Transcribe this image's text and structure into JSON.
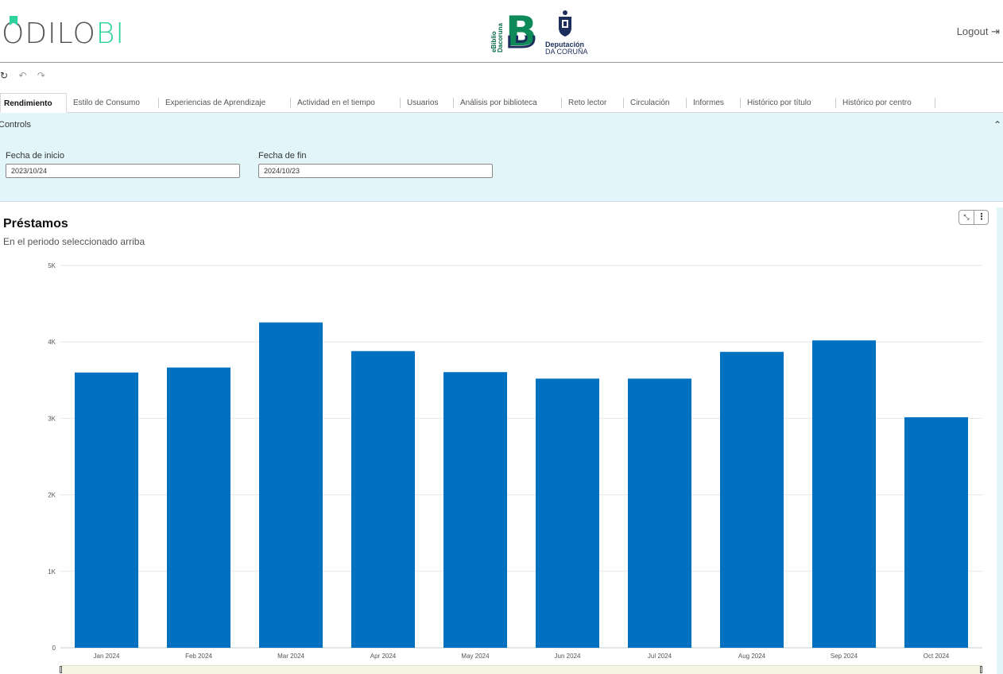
{
  "header": {
    "brand_main": "ODILO",
    "brand_accent": "BI",
    "ebiblio_label": "eBiblio Dacoruna",
    "partner_line1": "Deputación",
    "partner_line2": "DA CORUÑA",
    "logout_label": "Logout"
  },
  "toolbar": {
    "refresh_icon": "refresh-icon",
    "undo_icon": "undo-icon",
    "redo_icon": "redo-icon"
  },
  "tabs": [
    {
      "label": "Rendimiento",
      "active": true
    },
    {
      "label": "Estilo de Consumo"
    },
    {
      "label": "Experiencias de Aprendizaje"
    },
    {
      "label": "Actividad en el tiempo"
    },
    {
      "label": "Usuarios"
    },
    {
      "label": "Análisis por biblioteca"
    },
    {
      "label": "Reto lector"
    },
    {
      "label": "Circulación"
    },
    {
      "label": "Informes"
    },
    {
      "label": "Histórico por título"
    },
    {
      "label": "Histórico por centro"
    }
  ],
  "controls": {
    "title": "Controls",
    "start_label": "Fecha de inicio",
    "start_value": "2023/10/24",
    "end_label": "Fecha de fin",
    "end_value": "2024/10/23"
  },
  "panel": {
    "title": "Préstamos",
    "subtitle": "En el periodo seleccionado arriba"
  },
  "chart_data": {
    "type": "bar",
    "title": "Préstamos",
    "subtitle": "En el periodo seleccionado arriba",
    "categories": [
      "Jan 2024",
      "Feb 2024",
      "Mar 2024",
      "Apr 2024",
      "May 2024",
      "Jun 2024",
      "Jul 2024",
      "Aug 2024",
      "Sep 2024",
      "Oct 2024"
    ],
    "values": [
      3600,
      3665,
      4255,
      3880,
      3605,
      3520,
      3520,
      3870,
      4020,
      3015
    ],
    "ylim": [
      0,
      5000
    ],
    "yticks": [
      0,
      1000,
      2000,
      3000,
      4000,
      5000
    ],
    "ytick_labels": [
      "0",
      "1K",
      "2K",
      "3K",
      "4K",
      "5K"
    ],
    "grid": true,
    "bar_color": "#0070c0"
  }
}
